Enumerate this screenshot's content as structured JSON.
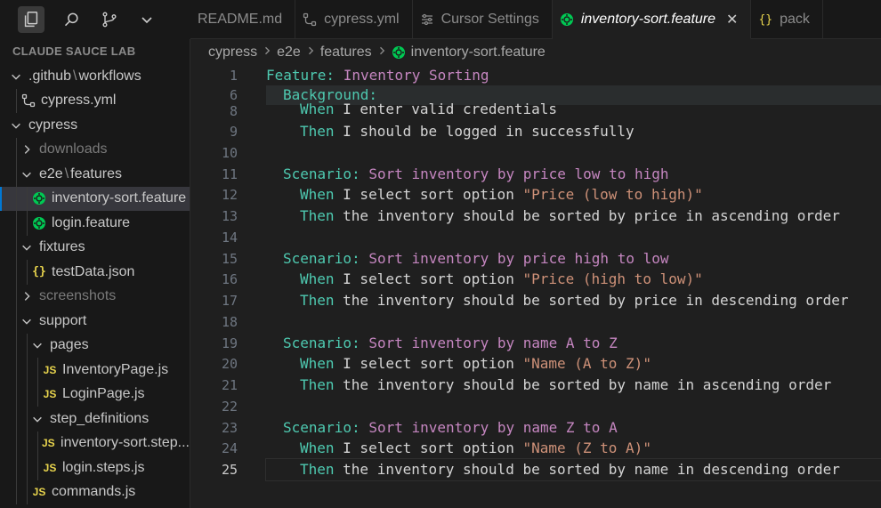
{
  "sidebar": {
    "title": "CLAUDE SAUCE LAB",
    "items": [
      {
        "label_a": ".github",
        "label_b": "workflows",
        "type": "folder-compound",
        "indent": 0,
        "expanded": true
      },
      {
        "label": "cypress.yml",
        "type": "workflow",
        "indent": 1
      },
      {
        "label": "cypress",
        "type": "folder",
        "indent": 0,
        "expanded": true
      },
      {
        "label": "downloads",
        "type": "folder",
        "indent": 1,
        "expanded": false,
        "dim": true
      },
      {
        "label_a": "e2e",
        "label_b": "features",
        "type": "folder-compound",
        "indent": 1,
        "expanded": true
      },
      {
        "label": "inventory-sort.feature",
        "type": "feature",
        "indent": 2,
        "selected": true
      },
      {
        "label": "login.feature",
        "type": "feature",
        "indent": 2
      },
      {
        "label": "fixtures",
        "type": "folder",
        "indent": 1,
        "expanded": true
      },
      {
        "label": "testData.json",
        "type": "json",
        "indent": 2
      },
      {
        "label": "screenshots",
        "type": "folder",
        "indent": 1,
        "expanded": false,
        "dim": true
      },
      {
        "label": "support",
        "type": "folder",
        "indent": 1,
        "expanded": true
      },
      {
        "label": "pages",
        "type": "folder",
        "indent": 2,
        "expanded": true
      },
      {
        "label": "InventoryPage.js",
        "type": "js",
        "indent": 3
      },
      {
        "label": "LoginPage.js",
        "type": "js",
        "indent": 3
      },
      {
        "label": "step_definitions",
        "type": "folder",
        "indent": 2,
        "expanded": true
      },
      {
        "label": "inventory-sort.step...",
        "type": "js",
        "indent": 3
      },
      {
        "label": "login.steps.js",
        "type": "js",
        "indent": 3
      },
      {
        "label": "commands.js",
        "type": "js",
        "indent": 2
      }
    ]
  },
  "tabs": [
    {
      "label": "README.md",
      "icon": "none"
    },
    {
      "label": "cypress.yml",
      "icon": "workflow-icon"
    },
    {
      "label": "Cursor Settings",
      "icon": "settings-icon"
    },
    {
      "label": "inventory-sort.feature",
      "icon": "cucumber-icon",
      "active": true,
      "close": "✕"
    },
    {
      "label": "pack",
      "icon": "json-icon"
    }
  ],
  "breadcrumb": [
    "cypress",
    "e2e",
    "features",
    "inventory-sort.feature"
  ],
  "code": [
    {
      "n": "1",
      "indent": 0,
      "parts": [
        [
          "kw-feature",
          "Feature:"
        ],
        [
          "plain",
          " "
        ],
        [
          "title-txt",
          "Inventory Sorting"
        ]
      ]
    },
    {
      "n": "6",
      "indent": 1,
      "parts": [
        [
          "kw-feature",
          "Background:"
        ]
      ]
    },
    {
      "n": "8",
      "indent": 2,
      "parts": [
        [
          "kw-step",
          "When"
        ],
        [
          "plain",
          " I enter valid credentials"
        ]
      ],
      "partial": true
    },
    {
      "n": "9",
      "indent": 2,
      "parts": [
        [
          "kw-step",
          "Then"
        ],
        [
          "plain",
          " I should be logged in successfully"
        ]
      ]
    },
    {
      "n": "10",
      "indent": 0,
      "parts": []
    },
    {
      "n": "11",
      "indent": 1,
      "parts": [
        [
          "kw-feature",
          "Scenario:"
        ],
        [
          "plain",
          " "
        ],
        [
          "title-txt",
          "Sort inventory by price low to high"
        ]
      ]
    },
    {
      "n": "12",
      "indent": 2,
      "parts": [
        [
          "kw-step",
          "When"
        ],
        [
          "plain",
          " I select sort option "
        ],
        [
          "str",
          "\"Price (low to high)\""
        ]
      ]
    },
    {
      "n": "13",
      "indent": 2,
      "parts": [
        [
          "kw-step",
          "Then"
        ],
        [
          "plain",
          " the inventory should be sorted by price in ascending order"
        ]
      ]
    },
    {
      "n": "14",
      "indent": 0,
      "parts": []
    },
    {
      "n": "15",
      "indent": 1,
      "parts": [
        [
          "kw-feature",
          "Scenario:"
        ],
        [
          "plain",
          " "
        ],
        [
          "title-txt",
          "Sort inventory by price high to low"
        ]
      ]
    },
    {
      "n": "16",
      "indent": 2,
      "parts": [
        [
          "kw-step",
          "When"
        ],
        [
          "plain",
          " I select sort option "
        ],
        [
          "str",
          "\"Price (high to low)\""
        ]
      ]
    },
    {
      "n": "17",
      "indent": 2,
      "parts": [
        [
          "kw-step",
          "Then"
        ],
        [
          "plain",
          " the inventory should be sorted by price in descending order"
        ]
      ]
    },
    {
      "n": "18",
      "indent": 0,
      "parts": []
    },
    {
      "n": "19",
      "indent": 1,
      "parts": [
        [
          "kw-feature",
          "Scenario:"
        ],
        [
          "plain",
          " "
        ],
        [
          "title-txt",
          "Sort inventory by name A to Z"
        ]
      ]
    },
    {
      "n": "20",
      "indent": 2,
      "parts": [
        [
          "kw-step",
          "When"
        ],
        [
          "plain",
          " I select sort option "
        ],
        [
          "str",
          "\"Name (A to Z)\""
        ]
      ]
    },
    {
      "n": "21",
      "indent": 2,
      "parts": [
        [
          "kw-step",
          "Then"
        ],
        [
          "plain",
          " the inventory should be sorted by name in ascending order"
        ]
      ]
    },
    {
      "n": "22",
      "indent": 0,
      "parts": []
    },
    {
      "n": "23",
      "indent": 1,
      "parts": [
        [
          "kw-feature",
          "Scenario:"
        ],
        [
          "plain",
          " "
        ],
        [
          "title-txt",
          "Sort inventory by name Z to A"
        ]
      ]
    },
    {
      "n": "24",
      "indent": 2,
      "parts": [
        [
          "kw-step",
          "When"
        ],
        [
          "plain",
          " I select sort option "
        ],
        [
          "str",
          "\"Name (Z to A)\""
        ]
      ]
    },
    {
      "n": "25",
      "indent": 2,
      "parts": [
        [
          "kw-step",
          "Then"
        ],
        [
          "plain",
          " the inventory should be sorted by name in descending order"
        ]
      ],
      "current": true
    }
  ]
}
